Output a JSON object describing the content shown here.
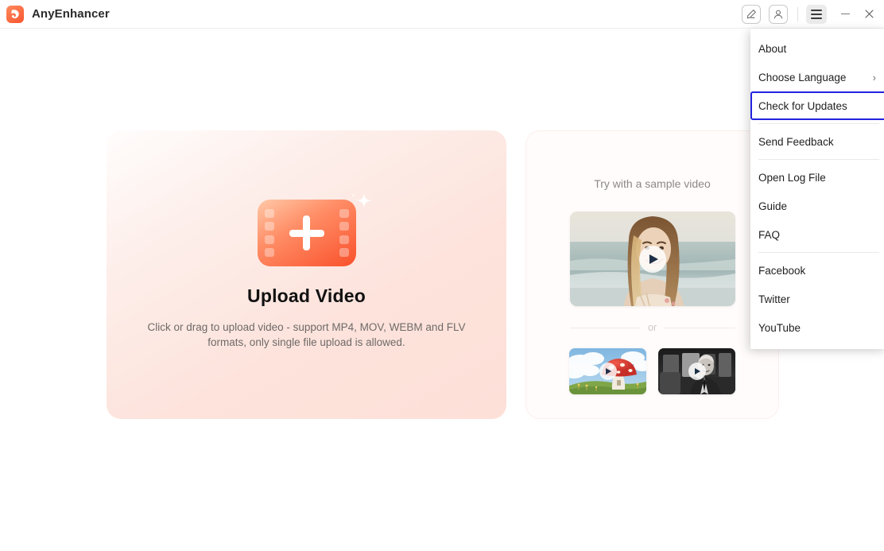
{
  "app": {
    "title": "AnyEnhancer",
    "logo_icon": "anyenhancer-logo-icon"
  },
  "titlebar": {
    "edit_icon": "pen-edit-icon",
    "account_icon": "user-account-icon",
    "menu_icon": "hamburger-menu-icon",
    "minimize_icon": "minimize-icon",
    "close_icon": "close-icon"
  },
  "upload": {
    "icon": "film-strip-plus-icon",
    "sparkle_icon": "sparkle-icon",
    "title": "Upload Video",
    "description": "Click or drag to upload video - support MP4, MOV, WEBM and FLV formats, only single file upload is allowed."
  },
  "sample": {
    "title": "Try with a sample video",
    "or_label": "or",
    "featured": {
      "name": "beach-woman-sample-video",
      "play_icon": "play-icon"
    },
    "thumbnails": [
      {
        "name": "mushroom-house-sample-video",
        "play_icon": "play-icon"
      },
      {
        "name": "vintage-bw-man-sample-video",
        "play_icon": "play-icon"
      }
    ]
  },
  "menu": {
    "items": [
      {
        "label": "About",
        "type": "item",
        "focused": false,
        "submenu": false
      },
      {
        "label": "Choose Language",
        "type": "item",
        "focused": false,
        "submenu": true,
        "chevron": "›"
      },
      {
        "label": "Check for Updates",
        "type": "item",
        "focused": true,
        "submenu": false
      },
      {
        "label": "Send Feedback",
        "type": "item",
        "focused": false,
        "submenu": false
      },
      {
        "label": "Open Log File",
        "type": "item",
        "focused": false,
        "submenu": false
      },
      {
        "label": "Guide",
        "type": "item",
        "focused": false,
        "submenu": false
      },
      {
        "label": "FAQ",
        "type": "item",
        "focused": false,
        "submenu": false
      },
      {
        "label": "Facebook",
        "type": "item",
        "focused": false,
        "submenu": false
      },
      {
        "label": "Twitter",
        "type": "item",
        "focused": false,
        "submenu": false
      },
      {
        "label": "YouTube",
        "type": "item",
        "focused": false,
        "submenu": false
      }
    ],
    "divider_after": [
      2,
      3,
      6
    ],
    "focus_color": "#2323e0"
  },
  "colors": {
    "brand_orange": "#f9512f",
    "upload_card_bg": "#fde2da",
    "page_bg": "#ffffff",
    "text_primary": "#111111",
    "text_muted": "#6e6a68"
  }
}
